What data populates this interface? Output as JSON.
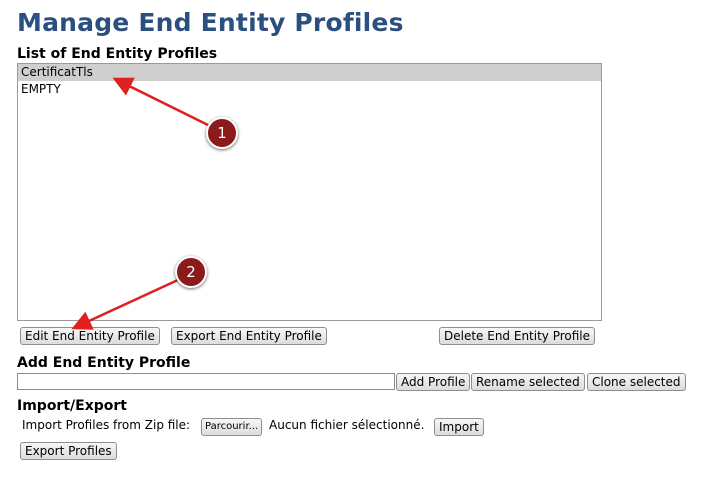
{
  "page": {
    "title": "Manage End Entity Profiles"
  },
  "list_section": {
    "title": "List of End Entity Profiles",
    "items": [
      "CertificatTls",
      "EMPTY"
    ],
    "selected_index": 0
  },
  "list_actions": {
    "edit_label": "Edit End Entity Profile",
    "export_label": "Export End Entity Profile",
    "delete_label": "Delete End Entity Profile"
  },
  "add_section": {
    "title": "Add End Entity Profile",
    "input_value": "",
    "add_label": "Add Profile",
    "rename_label": "Rename selected",
    "clone_label": "Clone selected"
  },
  "import_export": {
    "title": "Import/Export",
    "import_label": "Import Profiles from Zip file:",
    "browse_label": "Parcourir...",
    "no_file_label": "Aucun fichier sélectionné.",
    "import_button": "Import",
    "export_button": "Export Profiles"
  },
  "annotations": {
    "callout_1": "1",
    "callout_2": "2",
    "arrow_color": "#e02020",
    "badge_color": "#8b1a1a"
  }
}
